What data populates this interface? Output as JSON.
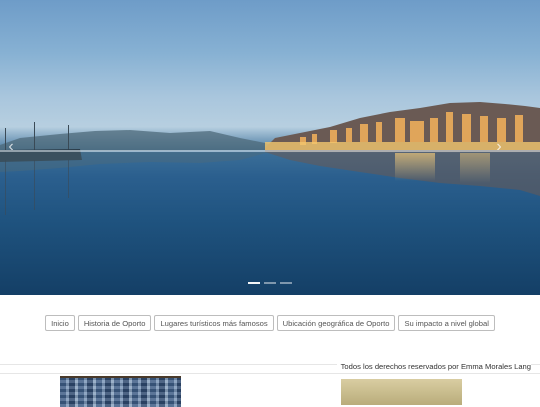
{
  "hero": {
    "image": "porto-douro-river-night-panorama",
    "slides": 3,
    "active_slide": 1,
    "prev_icon": "chevron-left-icon",
    "next_icon": "chevron-right-icon"
  },
  "nav": {
    "items": [
      {
        "label": "Inicio"
      },
      {
        "label": "Historia de Oporto"
      },
      {
        "label": "Lugares turísticos más famosos"
      },
      {
        "label": "Ubicación geográfica de Oporto"
      },
      {
        "label": "Su impacto a nivel global"
      }
    ]
  },
  "footer": {
    "copyright": "Todos los derechos reservados por Emma Morales Lang"
  },
  "gallery": {
    "items": [
      {
        "image": "azulejo-tile-wall"
      },
      {
        "image": "golden-landscape"
      }
    ]
  },
  "colors": {
    "sky": "#87b1d3",
    "river": "#1f537f",
    "button_border": "#bdbdbd",
    "button_text": "#555555"
  }
}
